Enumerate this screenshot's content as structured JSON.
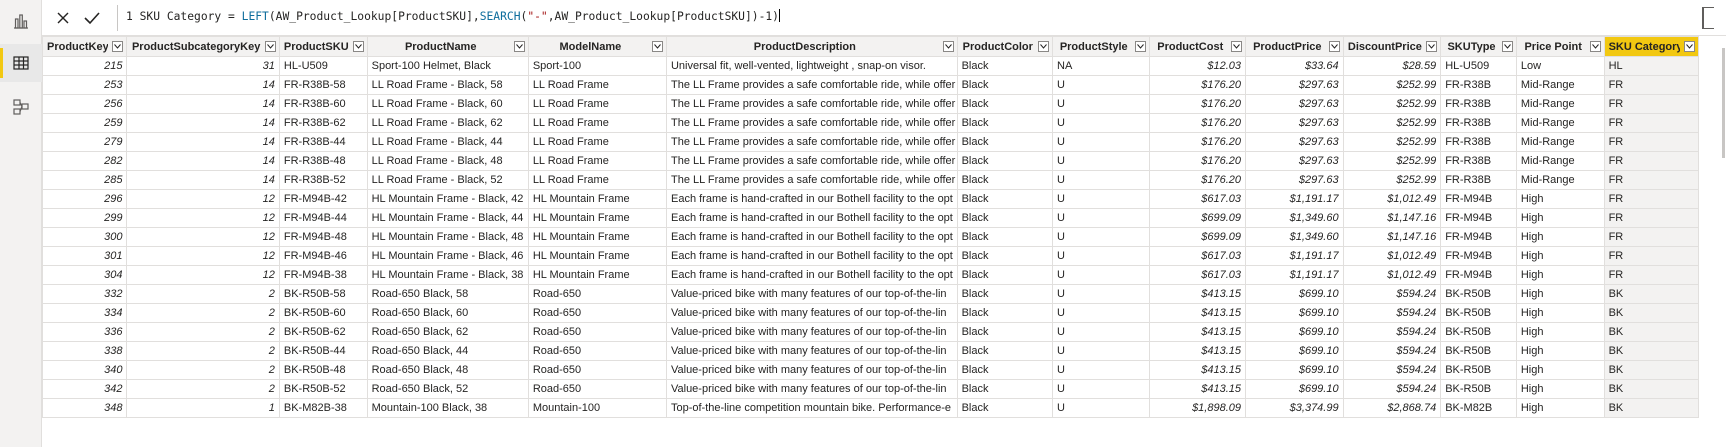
{
  "rail": {
    "items": [
      {
        "name": "report-view-icon"
      },
      {
        "name": "data-view-icon"
      },
      {
        "name": "model-view-icon"
      }
    ]
  },
  "formula": {
    "line_no": "1",
    "part1": " SKU Category = ",
    "fn1": "LEFT",
    "part2": "(AW_Product_Lookup[ProductSKU],",
    "fn2": "SEARCH",
    "part3": "(",
    "str": "\"-\"",
    "part4": ",AW_Product_Lookup[ProductSKU])-1)"
  },
  "columns": [
    "ProductKey",
    "ProductSubcategoryKey",
    "ProductSKU",
    "ProductName",
    "ModelName",
    "ProductDescription",
    "ProductColor",
    "ProductStyle",
    "ProductCost",
    "ProductPrice",
    "DiscountPrice",
    "SKUType",
    "Price Point",
    "SKU Category"
  ],
  "rows": [
    [
      "215",
      "31",
      "HL-U509",
      "Sport-100 Helmet, Black",
      "Sport-100",
      "Universal fit, well-vented, lightweight , snap-on visor.",
      "Black",
      "NA",
      "$12.03",
      "$33.64",
      "$28.59",
      "HL-U509",
      "Low",
      "HL"
    ],
    [
      "253",
      "14",
      "FR-R38B-58",
      "LL Road Frame - Black, 58",
      "LL Road Frame",
      "The LL Frame provides a safe comfortable ride, while offer",
      "Black",
      "U",
      "$176.20",
      "$297.63",
      "$252.99",
      "FR-R38B",
      "Mid-Range",
      "FR"
    ],
    [
      "256",
      "14",
      "FR-R38B-60",
      "LL Road Frame - Black, 60",
      "LL Road Frame",
      "The LL Frame provides a safe comfortable ride, while offer",
      "Black",
      "U",
      "$176.20",
      "$297.63",
      "$252.99",
      "FR-R38B",
      "Mid-Range",
      "FR"
    ],
    [
      "259",
      "14",
      "FR-R38B-62",
      "LL Road Frame - Black, 62",
      "LL Road Frame",
      "The LL Frame provides a safe comfortable ride, while offer",
      "Black",
      "U",
      "$176.20",
      "$297.63",
      "$252.99",
      "FR-R38B",
      "Mid-Range",
      "FR"
    ],
    [
      "279",
      "14",
      "FR-R38B-44",
      "LL Road Frame - Black, 44",
      "LL Road Frame",
      "The LL Frame provides a safe comfortable ride, while offer",
      "Black",
      "U",
      "$176.20",
      "$297.63",
      "$252.99",
      "FR-R38B",
      "Mid-Range",
      "FR"
    ],
    [
      "282",
      "14",
      "FR-R38B-48",
      "LL Road Frame - Black, 48",
      "LL Road Frame",
      "The LL Frame provides a safe comfortable ride, while offer",
      "Black",
      "U",
      "$176.20",
      "$297.63",
      "$252.99",
      "FR-R38B",
      "Mid-Range",
      "FR"
    ],
    [
      "285",
      "14",
      "FR-R38B-52",
      "LL Road Frame - Black, 52",
      "LL Road Frame",
      "The LL Frame provides a safe comfortable ride, while offer",
      "Black",
      "U",
      "$176.20",
      "$297.63",
      "$252.99",
      "FR-R38B",
      "Mid-Range",
      "FR"
    ],
    [
      "296",
      "12",
      "FR-M94B-42",
      "HL Mountain Frame - Black, 42",
      "HL Mountain Frame",
      "Each frame is hand-crafted in our Bothell facility to the opt",
      "Black",
      "U",
      "$617.03",
      "$1,191.17",
      "$1,012.49",
      "FR-M94B",
      "High",
      "FR"
    ],
    [
      "299",
      "12",
      "FR-M94B-44",
      "HL Mountain Frame - Black, 44",
      "HL Mountain Frame",
      "Each frame is hand-crafted in our Bothell facility to the opt",
      "Black",
      "U",
      "$699.09",
      "$1,349.60",
      "$1,147.16",
      "FR-M94B",
      "High",
      "FR"
    ],
    [
      "300",
      "12",
      "FR-M94B-48",
      "HL Mountain Frame - Black, 48",
      "HL Mountain Frame",
      "Each frame is hand-crafted in our Bothell facility to the opt",
      "Black",
      "U",
      "$699.09",
      "$1,349.60",
      "$1,147.16",
      "FR-M94B",
      "High",
      "FR"
    ],
    [
      "301",
      "12",
      "FR-M94B-46",
      "HL Mountain Frame - Black, 46",
      "HL Mountain Frame",
      "Each frame is hand-crafted in our Bothell facility to the opt",
      "Black",
      "U",
      "$617.03",
      "$1,191.17",
      "$1,012.49",
      "FR-M94B",
      "High",
      "FR"
    ],
    [
      "304",
      "12",
      "FR-M94B-38",
      "HL Mountain Frame - Black, 38",
      "HL Mountain Frame",
      "Each frame is hand-crafted in our Bothell facility to the opt",
      "Black",
      "U",
      "$617.03",
      "$1,191.17",
      "$1,012.49",
      "FR-M94B",
      "High",
      "FR"
    ],
    [
      "332",
      "2",
      "BK-R50B-58",
      "Road-650 Black, 58",
      "Road-650",
      "Value-priced bike with many features of our top-of-the-lin",
      "Black",
      "U",
      "$413.15",
      "$699.10",
      "$594.24",
      "BK-R50B",
      "High",
      "BK"
    ],
    [
      "334",
      "2",
      "BK-R50B-60",
      "Road-650 Black, 60",
      "Road-650",
      "Value-priced bike with many features of our top-of-the-lin",
      "Black",
      "U",
      "$413.15",
      "$699.10",
      "$594.24",
      "BK-R50B",
      "High",
      "BK"
    ],
    [
      "336",
      "2",
      "BK-R50B-62",
      "Road-650 Black, 62",
      "Road-650",
      "Value-priced bike with many features of our top-of-the-lin",
      "Black",
      "U",
      "$413.15",
      "$699.10",
      "$594.24",
      "BK-R50B",
      "High",
      "BK"
    ],
    [
      "338",
      "2",
      "BK-R50B-44",
      "Road-650 Black, 44",
      "Road-650",
      "Value-priced bike with many features of our top-of-the-lin",
      "Black",
      "U",
      "$413.15",
      "$699.10",
      "$594.24",
      "BK-R50B",
      "High",
      "BK"
    ],
    [
      "340",
      "2",
      "BK-R50B-48",
      "Road-650 Black, 48",
      "Road-650",
      "Value-priced bike with many features of our top-of-the-lin",
      "Black",
      "U",
      "$413.15",
      "$699.10",
      "$594.24",
      "BK-R50B",
      "High",
      "BK"
    ],
    [
      "342",
      "2",
      "BK-R50B-52",
      "Road-650 Black, 52",
      "Road-650",
      "Value-priced bike with many features of our top-of-the-lin",
      "Black",
      "U",
      "$413.15",
      "$699.10",
      "$594.24",
      "BK-R50B",
      "High",
      "BK"
    ],
    [
      "348",
      "1",
      "BK-M82B-38",
      "Mountain-100 Black, 38",
      "Mountain-100",
      "Top-of-the-line competition mountain bike. Performance-e",
      "Black",
      "U",
      "$1,898.09",
      "$3,374.99",
      "$2,868.74",
      "BK-M82B",
      "High",
      "BK"
    ]
  ],
  "colors": {
    "accent": "#f2c811",
    "header_bg": "#f3f2f1",
    "grid_line": "#e1dfdd"
  }
}
